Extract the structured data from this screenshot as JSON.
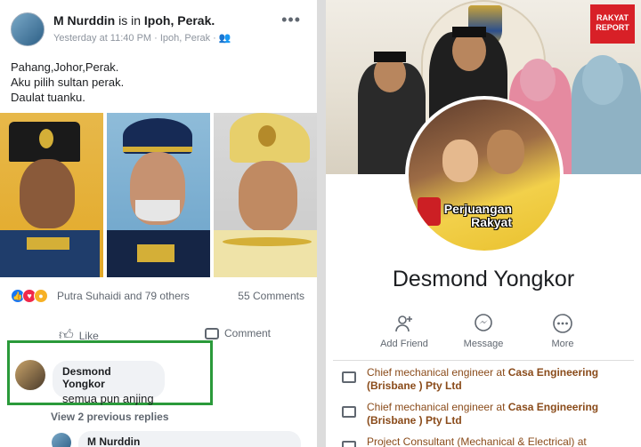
{
  "post": {
    "author": "M Nurddin",
    "is_in": "is in",
    "location": "Ipoh, Perak.",
    "meta": "Yesterday at 11:40 PM · Ipoh, Perak ·",
    "more_icon": "more-horizontal-icon",
    "lines": [
      "Pahang,Johor,Perak.",
      "Aku pilih sultan perak.",
      "Daulat tuanku."
    ],
    "reactions_text": "Putra Suhaidi and 79 others",
    "comments_count": "55 Comments",
    "like_label": "Like",
    "comment_label": "Comment"
  },
  "comment": {
    "author": "Desmond Yongkor",
    "text": "semua pun anjing"
  },
  "replies": {
    "view_previous": "View 2 previous replies",
    "reply_author": "M Nurddin"
  },
  "profile": {
    "name": "Desmond Yongkor",
    "logo_text": "RAKYAT REPORT",
    "pic_caption": "Perjuangan Rakyat",
    "actions": [
      "Add Friend",
      "Message",
      "More"
    ],
    "work": [
      {
        "role": "Chief mechanical engineer at ",
        "company": "Casa Engineering (Brisbane ) Pty Ltd"
      },
      {
        "role": "Chief mechanical engineer at ",
        "company": "Casa Engineering (Brisbane ) Pty Ltd"
      },
      {
        "role": "Project Consultant (Mechanical & Electrical) at",
        "company": ""
      }
    ]
  },
  "colors": {
    "highlight": "#2a9a3a",
    "facebook_blue": "#1877f2",
    "logo_red": "#d82027"
  }
}
